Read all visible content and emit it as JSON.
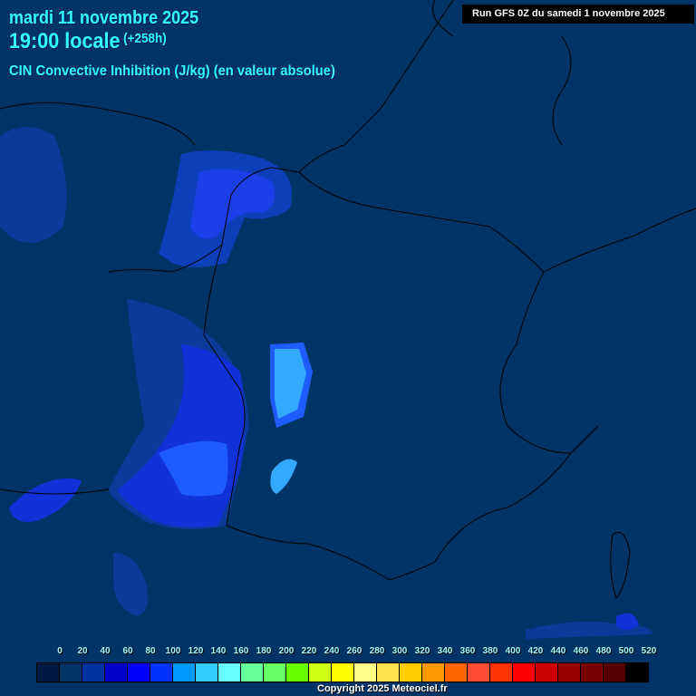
{
  "header": {
    "date": "mardi 11 novembre 2025",
    "time": "19:00 locale",
    "lead": "(+258h)",
    "parameter": "CIN Convective Inhibition (J/kg) (en valeur absolue)",
    "run": "Run GFS 0Z du samedi 1 novembre 2025"
  },
  "legend": {
    "labels": [
      "0",
      "20",
      "40",
      "60",
      "80",
      "100",
      "120",
      "140",
      "160",
      "180",
      "200",
      "220",
      "240",
      "260",
      "280",
      "300",
      "320",
      "340",
      "360",
      "380",
      "400",
      "420",
      "440",
      "460",
      "480",
      "500",
      "520"
    ],
    "colors": [
      "#001a44",
      "#003366",
      "#0033a0",
      "#0000cc",
      "#0000ff",
      "#0033ff",
      "#0099ff",
      "#33ccff",
      "#66ffff",
      "#66ff99",
      "#66ff66",
      "#66ff00",
      "#ccff11",
      "#ffff00",
      "#ffff88",
      "#ffe24d",
      "#ffcc00",
      "#ff9900",
      "#ff6600",
      "#ff4d33",
      "#ff3300",
      "#ff0000",
      "#cc0000",
      "#990000",
      "#770000",
      "#550000",
      "#000000"
    ]
  },
  "copyright": "Copyright 2025 Meteociel.fr"
}
